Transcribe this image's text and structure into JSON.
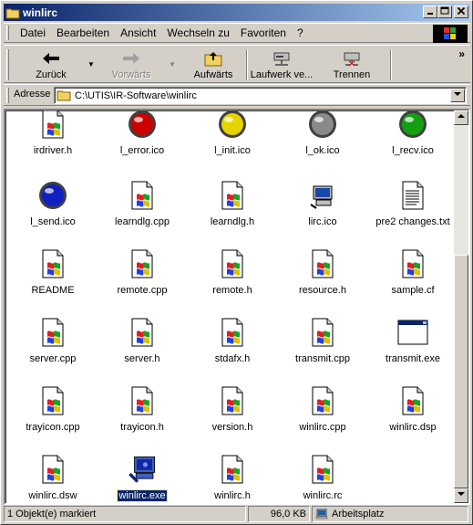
{
  "window": {
    "title": "winlirc"
  },
  "menu": [
    {
      "label": "Datei"
    },
    {
      "label": "Bearbeiten"
    },
    {
      "label": "Ansicht"
    },
    {
      "label": "Wechseln zu"
    },
    {
      "label": "Favoriten"
    },
    {
      "label": "?"
    }
  ],
  "toolbar": {
    "back": "Zurück",
    "forward": "Vorwärts",
    "up": "Aufwärts",
    "map_drive": "Laufwerk ve...",
    "disconnect": "Trennen",
    "more": "»"
  },
  "address": {
    "label": "Adresse",
    "path": "C:\\UTIS\\IR-Software\\winlirc"
  },
  "files": [
    {
      "name": "irdriver.h",
      "icon": "cpp-source-icon"
    },
    {
      "name": "l_error.ico",
      "icon": "red-light-icon",
      "color": "#cc0000"
    },
    {
      "name": "l_init.ico",
      "icon": "yellow-light-icon",
      "color": "#e6d400"
    },
    {
      "name": "l_ok.ico",
      "icon": "gray-light-icon",
      "color": "#8a8a8a"
    },
    {
      "name": "l_recv.ico",
      "icon": "green-light-icon",
      "color": "#12a012"
    },
    {
      "name": "l_send.ico",
      "icon": "blue-light-icon",
      "color": "#1020c0"
    },
    {
      "name": "learndlg.cpp",
      "icon": "cpp-source-icon"
    },
    {
      "name": "learndlg.h",
      "icon": "cpp-source-icon"
    },
    {
      "name": "lirc.ico",
      "icon": "computer-icon"
    },
    {
      "name": "pre2 changes.txt",
      "icon": "text-file-icon"
    },
    {
      "name": "README",
      "icon": "cpp-source-icon"
    },
    {
      "name": "remote.cpp",
      "icon": "cpp-source-icon"
    },
    {
      "name": "remote.h",
      "icon": "cpp-source-icon"
    },
    {
      "name": "resource.h",
      "icon": "cpp-source-icon"
    },
    {
      "name": "sample.cf",
      "icon": "cpp-source-icon"
    },
    {
      "name": "server.cpp",
      "icon": "cpp-source-icon"
    },
    {
      "name": "server.h",
      "icon": "cpp-source-icon"
    },
    {
      "name": "stdafx.h",
      "icon": "cpp-source-icon"
    },
    {
      "name": "transmit.cpp",
      "icon": "cpp-source-icon"
    },
    {
      "name": "transmit.exe",
      "icon": "application-window-icon"
    },
    {
      "name": "trayicon.cpp",
      "icon": "cpp-source-icon"
    },
    {
      "name": "trayicon.h",
      "icon": "cpp-source-icon"
    },
    {
      "name": "version.h",
      "icon": "cpp-source-icon"
    },
    {
      "name": "winlirc.cpp",
      "icon": "cpp-source-icon"
    },
    {
      "name": "winlirc.dsp",
      "icon": "cpp-source-icon"
    },
    {
      "name": "winlirc.dsw",
      "icon": "cpp-source-icon"
    },
    {
      "name": "winlirc.exe",
      "icon": "winlirc-app-icon",
      "selected": true
    },
    {
      "name": "winlirc.h",
      "icon": "cpp-source-icon"
    },
    {
      "name": "winlirc.rc",
      "icon": "cpp-source-icon"
    }
  ],
  "status": {
    "selection": "1 Objekt(e) markiert",
    "size": "96,0 KB",
    "zone": "Arbeitsplatz"
  },
  "colors": {
    "title_active_start": "#0a246a",
    "title_active_end": "#a6caf0",
    "selection": "#0a246a",
    "face": "#d4d0c8"
  }
}
